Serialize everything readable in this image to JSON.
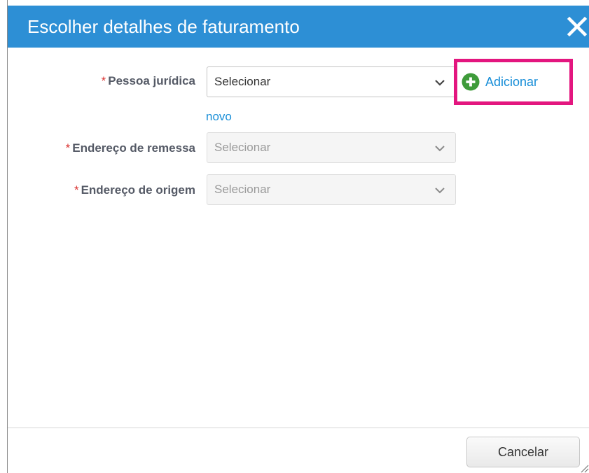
{
  "dialog": {
    "title": "Escolher detalhes de faturamento"
  },
  "fields": [
    {
      "label": "Pessoa jurídica",
      "required_marker": "*",
      "value": "Selecionar",
      "enabled": true
    },
    {
      "label": "Endereço de remessa",
      "required_marker": "*",
      "value": "Selecionar",
      "enabled": false
    },
    {
      "label": "Endereço de origem",
      "required_marker": "*",
      "value": "Selecionar",
      "enabled": false
    }
  ],
  "add_button": {
    "label": "Adicionar",
    "icon": "plus-circle-icon"
  },
  "novo_link": "novo",
  "footer": {
    "cancel_label": "Cancelar"
  },
  "colors": {
    "title_bar": "#2d8fd5",
    "link": "#1a8fd8",
    "add_icon": "#3e9b3a",
    "highlight": "#e3167f",
    "required": "#d9312f"
  }
}
